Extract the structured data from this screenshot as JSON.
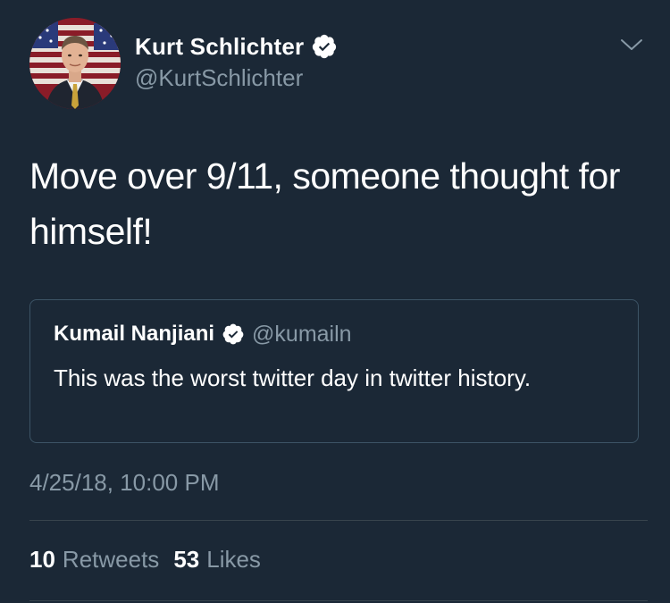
{
  "tweet": {
    "author": {
      "name": "Kurt Schlichter",
      "handle": "@KurtSchlichter",
      "verified": true,
      "avatar": "profile-photo-with-flag-background"
    },
    "menu_icon": "chevron-down-icon",
    "text": "Move over 9/11, someone thought for\nhimself!",
    "quoted": {
      "name": "Kumail Nanjiani",
      "handle": "@kumailn",
      "verified": true,
      "text": "This was the worst twitter day in twitter history."
    },
    "timestamp": "4/25/18, 10:00 PM",
    "stats": {
      "retweets_count": "10",
      "retweets_label": "Retweets",
      "likes_count": "53",
      "likes_label": "Likes"
    }
  },
  "colors": {
    "background": "#1b2836",
    "primary_text": "#ffffff",
    "secondary_text": "#8899a6",
    "border": "#3d5466",
    "verified_badge": "#ffffff"
  }
}
